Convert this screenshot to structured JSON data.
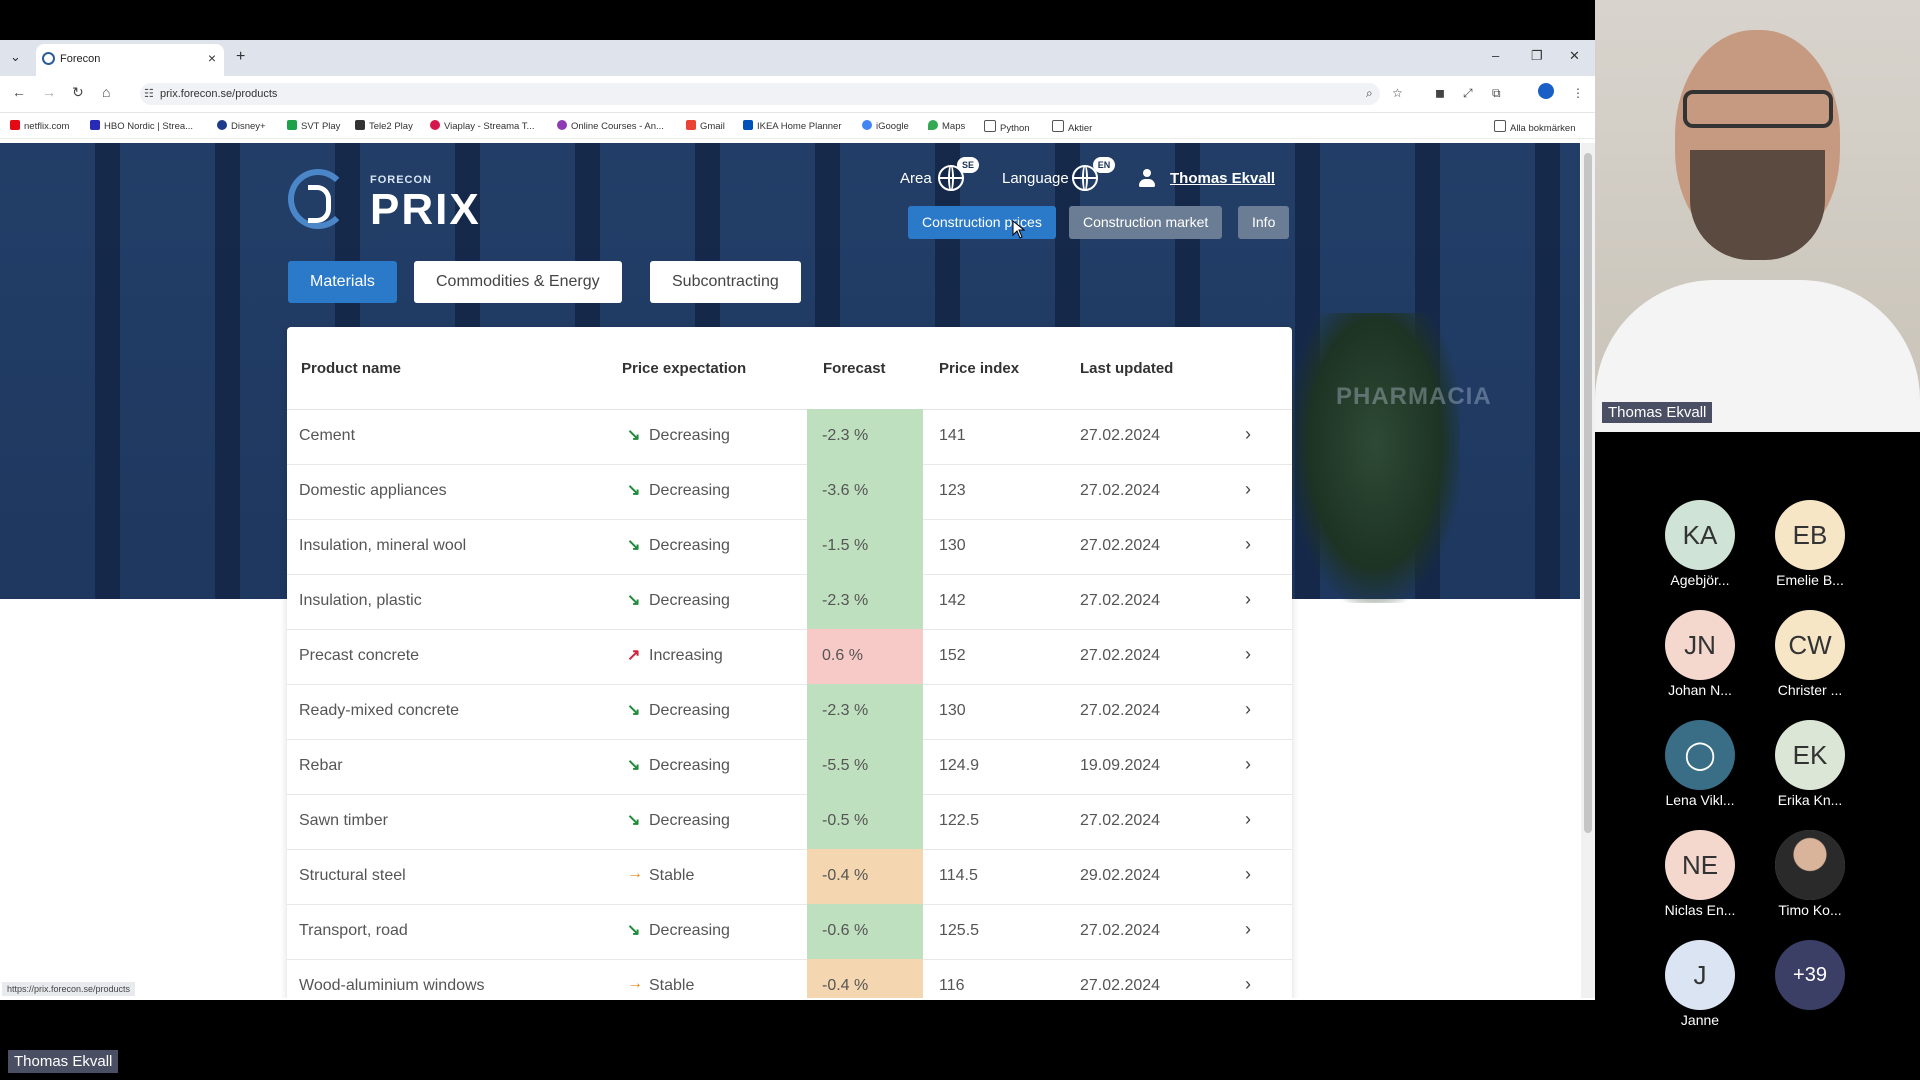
{
  "browser": {
    "tab_title": "Forecon",
    "url": "prix.forecon.se/products",
    "status_url": "https://prix.forecon.se/products",
    "bookmarks": [
      "netflix.com",
      "HBO Nordic | Strea...",
      "Disney+",
      "SVT Play",
      "Tele2 Play",
      "Viaplay - Streama T...",
      "Online Courses - An...",
      "Gmail",
      "IKEA Home Planner",
      "iGoogle",
      "Maps",
      "Python",
      "Aktier"
    ],
    "all_bookmarks": "Alla bokmärken"
  },
  "header": {
    "logo_small": "FORECON",
    "logo_big": "PRIX",
    "area_label": "Area",
    "area_code": "SE",
    "language_label": "Language",
    "language_code": "EN",
    "user_name": "Thomas Ekvall",
    "nav": [
      "Construction prices",
      "Construction market",
      "Info"
    ]
  },
  "subtabs": [
    "Materials",
    "Commodities & Energy",
    "Subcontracting"
  ],
  "table": {
    "columns": [
      "Product name",
      "Price expectation",
      "Forecast",
      "Price index",
      "Last updated"
    ],
    "rows": [
      {
        "name": "Cement",
        "expectation": "Decreasing",
        "forecast": "-2.3 %",
        "index": "141",
        "updated": "27.02.2024"
      },
      {
        "name": "Domestic appliances",
        "expectation": "Decreasing",
        "forecast": "-3.6 %",
        "index": "123",
        "updated": "27.02.2024"
      },
      {
        "name": "Insulation, mineral wool",
        "expectation": "Decreasing",
        "forecast": "-1.5 %",
        "index": "130",
        "updated": "27.02.2024"
      },
      {
        "name": "Insulation, plastic",
        "expectation": "Decreasing",
        "forecast": "-2.3 %",
        "index": "142",
        "updated": "27.02.2024"
      },
      {
        "name": "Precast concrete",
        "expectation": "Increasing",
        "forecast": "0.6 %",
        "index": "152",
        "updated": "27.02.2024"
      },
      {
        "name": "Ready-mixed concrete",
        "expectation": "Decreasing",
        "forecast": "-2.3 %",
        "index": "130",
        "updated": "27.02.2024"
      },
      {
        "name": "Rebar",
        "expectation": "Decreasing",
        "forecast": "-5.5 %",
        "index": "124.9",
        "updated": "19.09.2024"
      },
      {
        "name": "Sawn timber",
        "expectation": "Decreasing",
        "forecast": "-0.5 %",
        "index": "122.5",
        "updated": "27.02.2024"
      },
      {
        "name": "Structural steel",
        "expectation": "Stable",
        "forecast": "-0.4 %",
        "index": "114.5",
        "updated": "29.02.2024"
      },
      {
        "name": "Transport, road",
        "expectation": "Decreasing",
        "forecast": "-0.6 %",
        "index": "125.5",
        "updated": "27.02.2024"
      },
      {
        "name": "Wood-aluminium windows",
        "expectation": "Stable",
        "forecast": "-0.4 %",
        "index": "116",
        "updated": "27.02.2024"
      }
    ]
  },
  "colors": {
    "decreasing_bg": "#bfe0bf",
    "increasing_bg": "#f7c9c7",
    "stable_bg": "#f4d7b0",
    "decreasing_arrow": "#1e8a3a",
    "increasing_arrow": "#d0253a",
    "stable_arrow": "#e08a1a"
  },
  "meeting": {
    "speaker_name": "Thomas Ekvall",
    "presenter_label": "Thomas Ekvall",
    "participants": [
      {
        "initials": "KA",
        "name": "Agebjör...",
        "color": "#cfe3d6"
      },
      {
        "initials": "EB",
        "name": "Emelie B...",
        "color": "#f6e6c6"
      },
      {
        "initials": "JN",
        "name": "Johan N...",
        "color": "#f4d8cd"
      },
      {
        "initials": "CW",
        "name": "Christer ...",
        "color": "#f6e6c6"
      },
      {
        "initials": "",
        "name": "Lena Vikl...",
        "color": "#3a6e86"
      },
      {
        "initials": "EK",
        "name": "Erika Kn...",
        "color": "#dbe6d6"
      },
      {
        "initials": "NE",
        "name": "Niclas En...",
        "color": "#f4d8cd"
      },
      {
        "initials": "",
        "name": "Timo Ko...",
        "color": "#8c8f96"
      },
      {
        "initials": "J",
        "name": "Janne",
        "color": "#dbe4f2"
      }
    ],
    "more_count": "+39"
  }
}
